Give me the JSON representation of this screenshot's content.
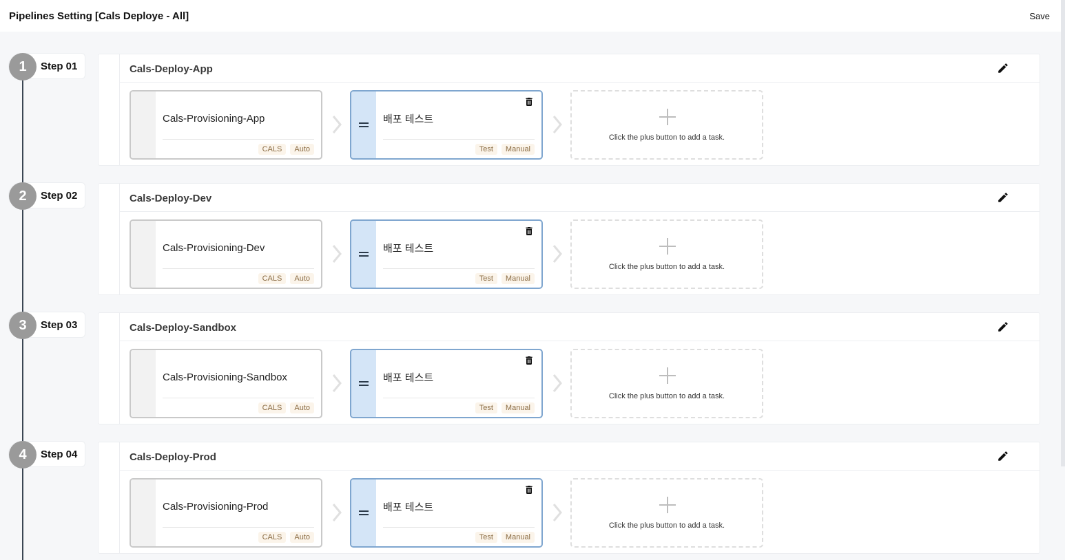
{
  "header": {
    "title": "Pipelines Setting [Cals Deploye - All]",
    "save_label": "Save"
  },
  "add_task_hint": "Click the plus button to add a task.",
  "stages": [
    {
      "step_number": "1",
      "step_label": "Step 01",
      "title": "Cals-Deploy-App",
      "tasks": [
        {
          "name": "Cals-Provisioning-App",
          "tags": [
            "CALS",
            "Auto"
          ]
        },
        {
          "name": "배포 테스트",
          "tags": [
            "Test",
            "Manual"
          ]
        }
      ]
    },
    {
      "step_number": "2",
      "step_label": "Step 02",
      "title": "Cals-Deploy-Dev",
      "tasks": [
        {
          "name": "Cals-Provisioning-Dev",
          "tags": [
            "CALS",
            "Auto"
          ]
        },
        {
          "name": "배포 테스트",
          "tags": [
            "Test",
            "Manual"
          ]
        }
      ]
    },
    {
      "step_number": "3",
      "step_label": "Step 03",
      "title": "Cals-Deploy-Sandbox",
      "tasks": [
        {
          "name": "Cals-Provisioning-Sandbox",
          "tags": [
            "CALS",
            "Auto"
          ]
        },
        {
          "name": "배포 테스트",
          "tags": [
            "Test",
            "Manual"
          ]
        }
      ]
    },
    {
      "step_number": "4",
      "step_label": "Step 04",
      "title": "Cals-Deploy-Prod",
      "tasks": [
        {
          "name": "Cals-Provisioning-Prod",
          "tags": [
            "CALS",
            "Auto"
          ]
        },
        {
          "name": "배포 테스트",
          "tags": [
            "Test",
            "Manual"
          ]
        }
      ]
    }
  ],
  "icons": {
    "edit": "pencil-icon",
    "delete": "trash-icon",
    "drag": "drag-handle-icon",
    "arrow": "chevron-right-icon",
    "add": "plus-icon"
  },
  "colors": {
    "selected_border": "#7fa6cf",
    "selected_fill": "#d4e5f7",
    "tag_text": "#8a6b42",
    "tag_bg": "#fbf4ea",
    "step_circle": "#9a9a9a",
    "timeline": "#3b4654"
  }
}
